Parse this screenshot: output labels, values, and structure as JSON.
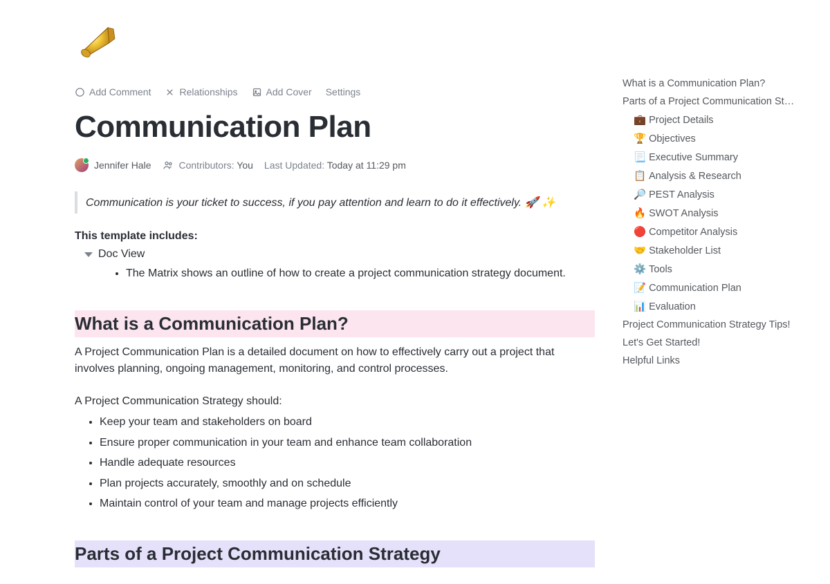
{
  "toolbar": {
    "add_comment": "Add Comment",
    "relationships": "Relationships",
    "add_cover": "Add Cover",
    "settings": "Settings"
  },
  "page": {
    "icon": "📣",
    "title": "Communication Plan"
  },
  "meta": {
    "author": "Jennifer Hale",
    "contributors_label": "Contributors:",
    "contributors_value": "You",
    "last_updated_label": "Last Updated:",
    "last_updated_value": "Today at 11:29 pm"
  },
  "quote": "Communication is your ticket to success, if you pay attention and learn to do it effectively. 🚀 ✨",
  "template_includes_label": "This template includes:",
  "doc_view": "Doc View",
  "doc_view_desc": "The Matrix shows an outline of how to create a project communication strategy document.",
  "section1": {
    "heading": "What is a Communication Plan?",
    "p1": "A Project Communication Plan is a detailed document on how to effectively carry out a project that involves planning, ongoing management, monitoring, and control processes.",
    "p2": "A Project Communication Strategy should:",
    "bullets": [
      "Keep your team and stakeholders on board",
      "Ensure proper communication in your team and enhance team collaboration",
      "Handle adequate resources",
      "Plan projects accurately, smoothly and on schedule",
      "Maintain control of your team and manage projects efficiently"
    ]
  },
  "section2": {
    "heading": "Parts of a Project Communication Strategy"
  },
  "toc": {
    "items": [
      {
        "label": "What is a Communication Plan?",
        "sub": false,
        "emoji": ""
      },
      {
        "label": "Parts of a Project Communication St…",
        "sub": false,
        "emoji": ""
      },
      {
        "label": "Project Details",
        "sub": true,
        "emoji": "💼"
      },
      {
        "label": "Objectives",
        "sub": true,
        "emoji": "🏆"
      },
      {
        "label": "Executive Summary",
        "sub": true,
        "emoji": "📃"
      },
      {
        "label": "Analysis & Research",
        "sub": true,
        "emoji": "📋"
      },
      {
        "label": "PEST Analysis",
        "sub": true,
        "emoji": "🔎"
      },
      {
        "label": "SWOT Analysis",
        "sub": true,
        "emoji": "🔥"
      },
      {
        "label": "Competitor Analysis",
        "sub": true,
        "emoji": "🔴"
      },
      {
        "label": "Stakeholder List",
        "sub": true,
        "emoji": "🤝"
      },
      {
        "label": "Tools",
        "sub": true,
        "emoji": "⚙️"
      },
      {
        "label": "Communication Plan",
        "sub": true,
        "emoji": "📝"
      },
      {
        "label": "Evaluation",
        "sub": true,
        "emoji": "📊"
      },
      {
        "label": "Project Communication Strategy Tips!",
        "sub": false,
        "emoji": ""
      },
      {
        "label": "Let's Get Started!",
        "sub": false,
        "emoji": ""
      },
      {
        "label": "Helpful Links",
        "sub": false,
        "emoji": ""
      }
    ]
  }
}
